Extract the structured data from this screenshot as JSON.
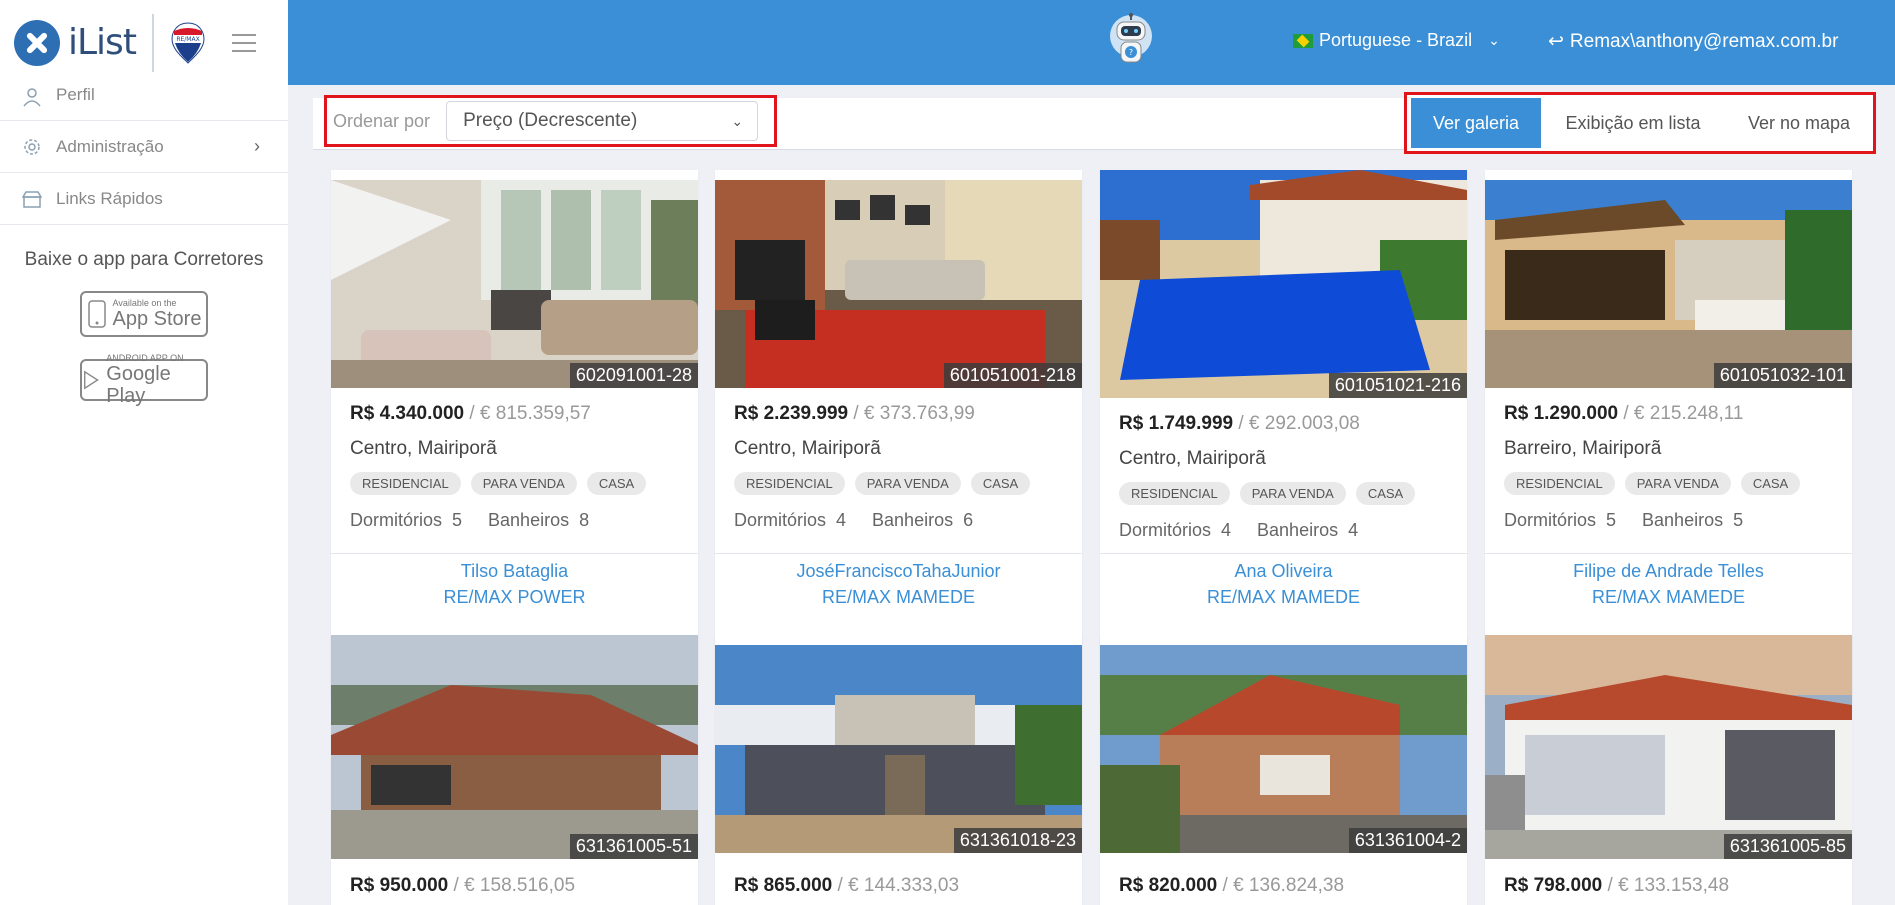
{
  "header": {
    "brand": "iList",
    "language": "Portuguese - Brazil",
    "user": "Remax\\anthony@remax.com.br"
  },
  "sidebar": {
    "items": [
      {
        "label": "Perfil",
        "icon": "user-icon"
      },
      {
        "label": "Administração",
        "icon": "gear-icon"
      },
      {
        "label": "Links Rápidos",
        "icon": "store-icon"
      }
    ],
    "app_title": "Baixe o app para Corretores",
    "app_store": {
      "small": "Available on the",
      "large": "App Store"
    },
    "google_play": {
      "small": "ANDROID APP ON",
      "large": "Google Play"
    }
  },
  "toolbar": {
    "sort_label": "Ordenar por",
    "sort_value": "Preço (Decrescente)",
    "views": [
      "Ver galeria",
      "Exibição em lista",
      "Ver no mapa"
    ]
  },
  "listings": [
    {
      "code": "602091001-28",
      "price_brl": "R$ 4.340.000",
      "price_eur": "/ € 815.359,57",
      "location": "Centro, Mairiporã",
      "tags": [
        "RESIDENCIAL",
        "PARA VENDA",
        "CASA"
      ],
      "bedrooms_label": "Dormitórios",
      "bedrooms": "5",
      "bathrooms_label": "Banheiros",
      "bathrooms": "8",
      "agent": "Tilso Bataglia",
      "office": "RE/MAX POWER"
    },
    {
      "code": "601051001-218",
      "price_brl": "R$ 2.239.999",
      "price_eur": "/ € 373.763,99",
      "location": "Centro, Mairiporã",
      "tags": [
        "RESIDENCIAL",
        "PARA VENDA",
        "CASA"
      ],
      "bedrooms_label": "Dormitórios",
      "bedrooms": "4",
      "bathrooms_label": "Banheiros",
      "bathrooms": "6",
      "agent": "JoséFranciscoTahaJunior",
      "office": "RE/MAX MAMEDE"
    },
    {
      "code": "601051021-216",
      "price_brl": "R$ 1.749.999",
      "price_eur": "/ € 292.003,08",
      "location": "Centro, Mairiporã",
      "tags": [
        "RESIDENCIAL",
        "PARA VENDA",
        "CASA"
      ],
      "bedrooms_label": "Dormitórios",
      "bedrooms": "4",
      "bathrooms_label": "Banheiros",
      "bathrooms": "4",
      "agent": "Ana Oliveira",
      "office": "RE/MAX MAMEDE"
    },
    {
      "code": "601051032-101",
      "price_brl": "R$ 1.290.000",
      "price_eur": "/ € 215.248,11",
      "location": "Barreiro, Mairiporã",
      "tags": [
        "RESIDENCIAL",
        "PARA VENDA",
        "CASA"
      ],
      "bedrooms_label": "Dormitórios",
      "bedrooms": "5",
      "bathrooms_label": "Banheiros",
      "bathrooms": "5",
      "agent": "Filipe de Andrade Telles",
      "office": "RE/MAX MAMEDE"
    },
    {
      "code": "631361005-51",
      "price_brl": "R$ 950.000",
      "price_eur": "/ € 158.516,05"
    },
    {
      "code": "631361018-23",
      "price_brl": "R$ 865.000",
      "price_eur": "/ € 144.333,03"
    },
    {
      "code": "631361004-2",
      "price_brl": "R$ 820.000",
      "price_eur": "/ € 136.824,38"
    },
    {
      "code": "631361005-85",
      "price_brl": "R$ 798.000",
      "price_eur": "/ € 133.153,48"
    }
  ]
}
